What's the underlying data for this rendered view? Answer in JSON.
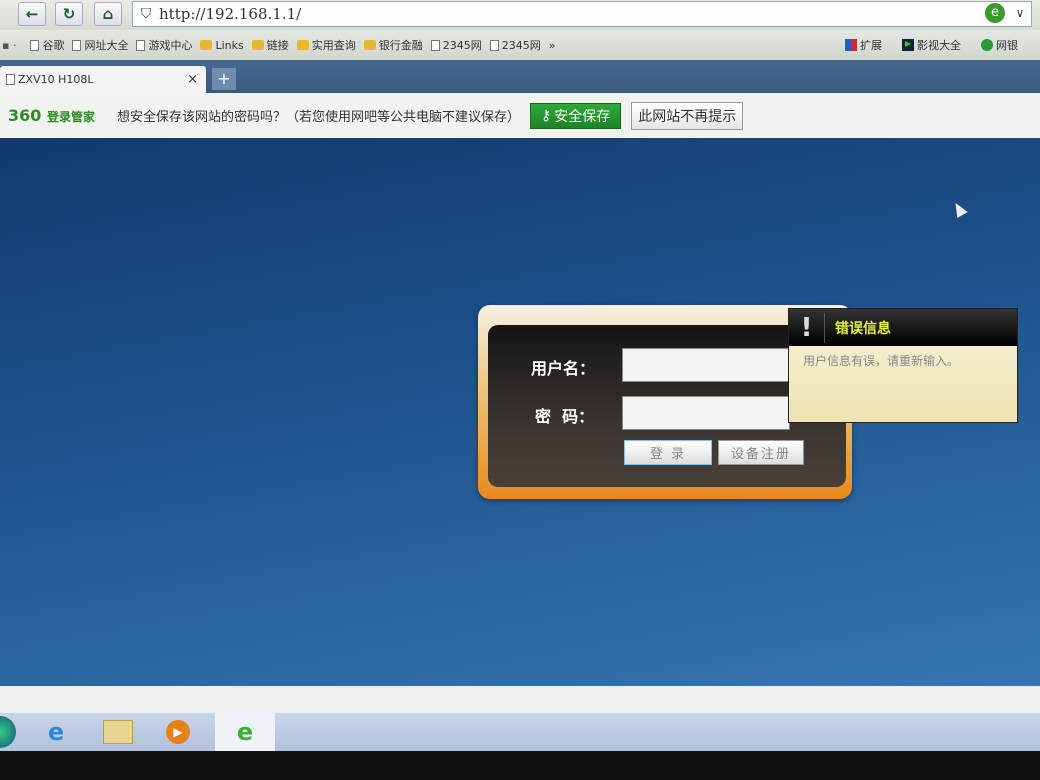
{
  "browser": {
    "url": "http://192.168.1.1/",
    "nav_icons": [
      "back-icon",
      "refresh-icon",
      "home-icon",
      "shield-icon"
    ],
    "bookmarks": [
      {
        "label": "谷歌",
        "icon": "page"
      },
      {
        "label": "网址大全",
        "icon": "page"
      },
      {
        "label": "游戏中心",
        "icon": "page"
      },
      {
        "label": "Links",
        "icon": "folder"
      },
      {
        "label": "链接",
        "icon": "folder"
      },
      {
        "label": "实用查询",
        "icon": "folder"
      },
      {
        "label": "银行金融",
        "icon": "folder"
      },
      {
        "label": "2345网",
        "icon": "page"
      },
      {
        "label": "2345网",
        "icon": "page"
      }
    ],
    "bookmarks_more": "»",
    "right_tools": [
      {
        "label": "扩展"
      },
      {
        "label": "影视大全"
      },
      {
        "label": "网银"
      }
    ],
    "tab": {
      "title": "ZXV10 H108L",
      "close": "×"
    },
    "new_tab": "+"
  },
  "password_bar": {
    "logo": "360",
    "logo_sub": "登录管家",
    "prompt": "想安全保存该网站的密码吗？（若您使用网吧等公共电脑不建议保存）",
    "save_label": "安全保存",
    "never_label": "此网站不再提示"
  },
  "login": {
    "username_label": "用户名：",
    "password_label": "密  码：",
    "username_value": "",
    "password_value": "",
    "login_button": "登 录",
    "register_button": "设备注册"
  },
  "error_tooltip": {
    "title": "错误信息",
    "message": "用户信息有误，请重新输入。"
  },
  "colors": {
    "page_bg": "#1e508a",
    "login_accent": "#e88a1a",
    "save_green": "#2fa83a",
    "tooltip_title": "#e6f03a"
  },
  "taskbar": {
    "apps": [
      "start-orb",
      "internet-explorer",
      "file-explorer",
      "media-player",
      "360-browser"
    ]
  }
}
